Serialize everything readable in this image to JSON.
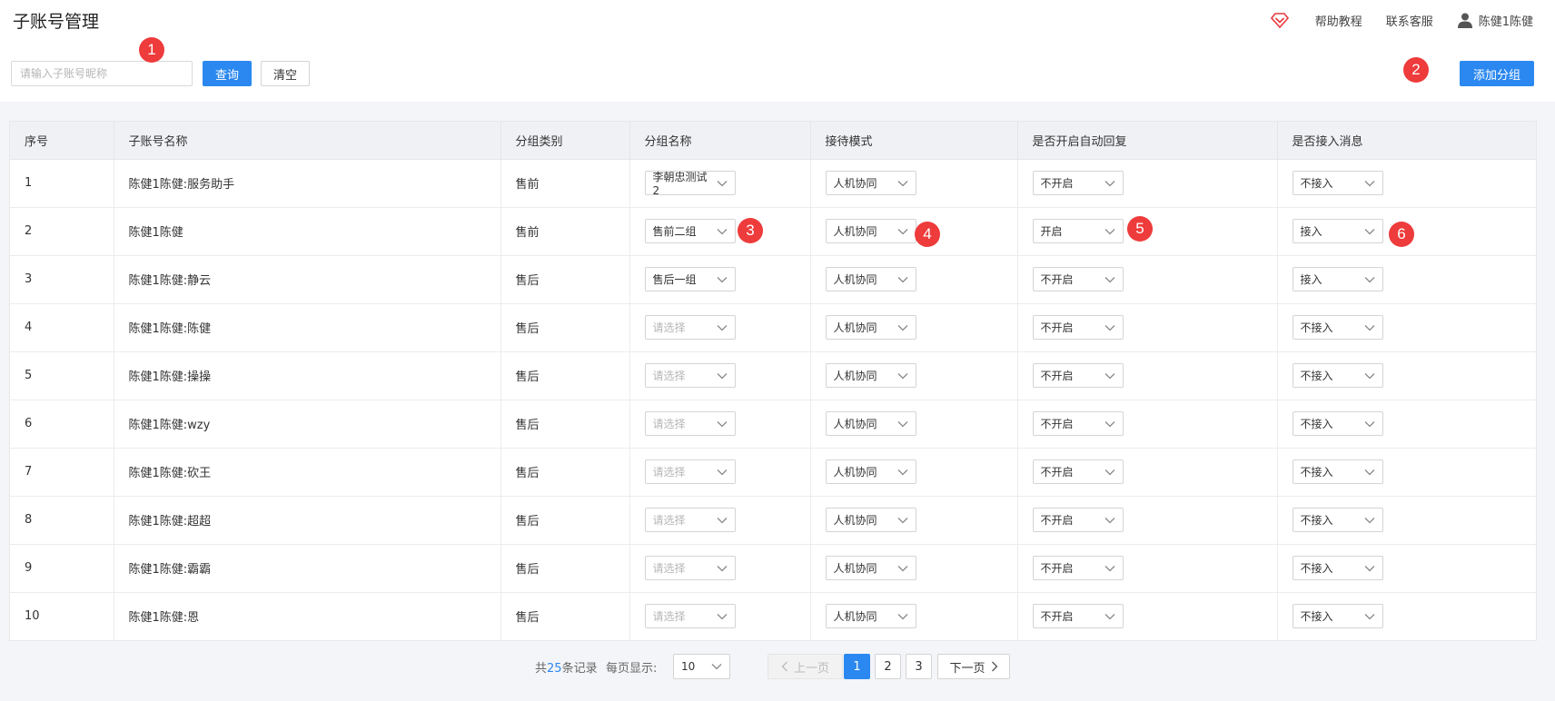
{
  "page_title": "子账号管理",
  "top_links": {
    "help": "帮助教程",
    "contact": "联系客服",
    "user": "陈健1陈健"
  },
  "search": {
    "placeholder": "请输入子账号昵称",
    "query_label": "查询",
    "clear_label": "清空"
  },
  "add_group_label": "添加分组",
  "markers": [
    "1",
    "2",
    "3",
    "4",
    "5",
    "6"
  ],
  "table": {
    "headers": [
      "序号",
      "子账号名称",
      "分组类别",
      "分组名称",
      "接待模式",
      "是否开启自动回复",
      "是否接入消息"
    ],
    "rows": [
      {
        "no": "1",
        "name": "陈健1陈健:服务助手",
        "category": "售前",
        "group": "李朝忠测试2",
        "group_placeholder": false,
        "mode": "人机协同",
        "auto_reply": "不开启",
        "msg": "不接入"
      },
      {
        "no": "2",
        "name": "陈健1陈健",
        "category": "售前",
        "group": "售前二组",
        "group_placeholder": false,
        "mode": "人机协同",
        "auto_reply": "开启",
        "msg": "接入"
      },
      {
        "no": "3",
        "name": "陈健1陈健:静云",
        "category": "售后",
        "group": "售后一组",
        "group_placeholder": false,
        "mode": "人机协同",
        "auto_reply": "不开启",
        "msg": "接入"
      },
      {
        "no": "4",
        "name": "陈健1陈健:陈健",
        "category": "售后",
        "group": "请选择",
        "group_placeholder": true,
        "mode": "人机协同",
        "auto_reply": "不开启",
        "msg": "不接入"
      },
      {
        "no": "5",
        "name": "陈健1陈健:操操",
        "category": "售后",
        "group": "请选择",
        "group_placeholder": true,
        "mode": "人机协同",
        "auto_reply": "不开启",
        "msg": "不接入"
      },
      {
        "no": "6",
        "name": "陈健1陈健:wzy",
        "category": "售后",
        "group": "请选择",
        "group_placeholder": true,
        "mode": "人机协同",
        "auto_reply": "不开启",
        "msg": "不接入"
      },
      {
        "no": "7",
        "name": "陈健1陈健:砍王",
        "category": "售后",
        "group": "请选择",
        "group_placeholder": true,
        "mode": "人机协同",
        "auto_reply": "不开启",
        "msg": "不接入"
      },
      {
        "no": "8",
        "name": "陈健1陈健:超超",
        "category": "售后",
        "group": "请选择",
        "group_placeholder": true,
        "mode": "人机协同",
        "auto_reply": "不开启",
        "msg": "不接入"
      },
      {
        "no": "9",
        "name": "陈健1陈健:霸霸",
        "category": "售后",
        "group": "请选择",
        "group_placeholder": true,
        "mode": "人机协同",
        "auto_reply": "不开启",
        "msg": "不接入"
      },
      {
        "no": "10",
        "name": "陈健1陈健:恩",
        "category": "售后",
        "group": "请选择",
        "group_placeholder": true,
        "mode": "人机协同",
        "auto_reply": "不开启",
        "msg": "不接入"
      }
    ]
  },
  "pagination": {
    "total_prefix": "共",
    "total_count": "25",
    "total_suffix": "条记录",
    "page_size_label": "每页显示:",
    "page_size": "10",
    "prev_label": "上一页",
    "pages": [
      "1",
      "2",
      "3"
    ],
    "current_page": "1",
    "next_label": "下一页"
  },
  "colors": {
    "primary": "#2b88f0",
    "marker": "#ee3b3b",
    "diamond_icon": "#e8383d"
  }
}
